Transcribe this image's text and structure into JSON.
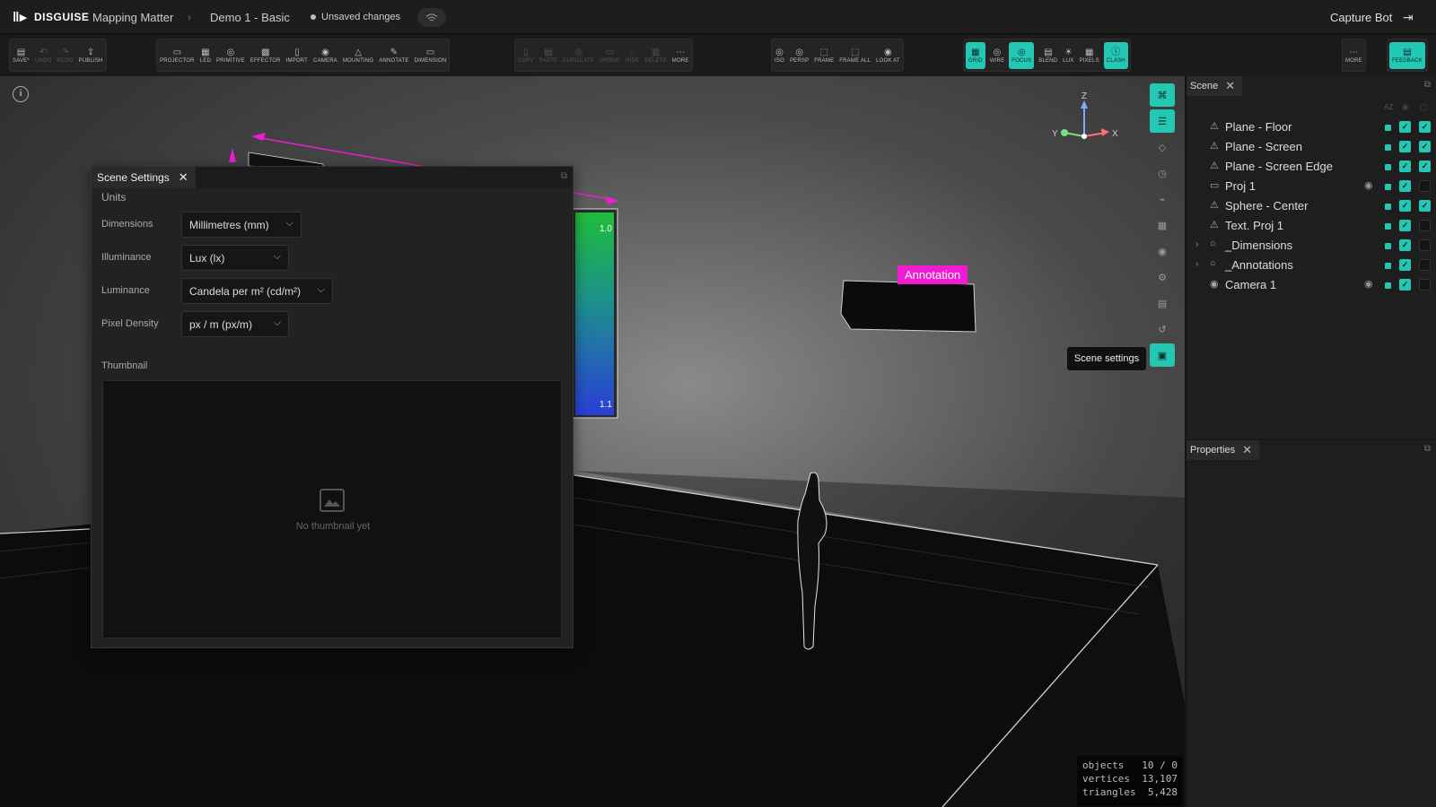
{
  "app": {
    "brand": "DISGUISE",
    "breadcrumb": [
      "Mapping Matter",
      "Demo 1 - Basic"
    ],
    "status": "Unsaved changes",
    "user": "Capture Bot"
  },
  "toolbar": {
    "groups": [
      [
        {
          "label": "SAVE*",
          "icon": "save-icon",
          "on": false,
          "dim": false
        },
        {
          "label": "UNDO",
          "icon": "undo-icon",
          "dim": true
        },
        {
          "label": "REDO",
          "icon": "redo-icon",
          "dim": true
        },
        {
          "label": "PUBLISH",
          "icon": "publish-icon",
          "dim": false
        }
      ],
      [
        {
          "label": "PROJECTOR",
          "icon": "projector-icon"
        },
        {
          "label": "LED",
          "icon": "led-icon"
        },
        {
          "label": "PRIMITIVE",
          "icon": "primitive-icon"
        },
        {
          "label": "EFFECTOR",
          "icon": "effector-icon"
        },
        {
          "label": "IMPORT",
          "icon": "import-icon"
        },
        {
          "label": "CAMERA",
          "icon": "camera-icon"
        },
        {
          "label": "MOUNTING",
          "icon": "mounting-icon"
        },
        {
          "label": "ANNOTATE",
          "icon": "annotate-icon"
        },
        {
          "label": "DIMENSION",
          "icon": "dimension-icon"
        }
      ],
      [
        {
          "label": "COPY",
          "icon": "copy-icon",
          "dim": true
        },
        {
          "label": "PASTE",
          "icon": "paste-icon",
          "dim": true
        },
        {
          "label": "DUPLICATE",
          "icon": "duplicate-icon",
          "dim": true
        },
        {
          "label": "GROUP",
          "icon": "group-icon",
          "dim": true
        },
        {
          "label": "HIDE",
          "icon": "hide-icon",
          "dim": true
        },
        {
          "label": "DELETE",
          "icon": "delete-icon",
          "dim": true
        },
        {
          "label": "MORE",
          "icon": "more-icon"
        }
      ],
      [
        {
          "label": "ISO",
          "icon": "iso-icon"
        },
        {
          "label": "PERSP",
          "icon": "persp-icon"
        },
        {
          "label": "FRAME",
          "icon": "frame-icon"
        },
        {
          "label": "FRAME ALL",
          "icon": "frame-all-icon"
        },
        {
          "label": "LOOK AT",
          "icon": "look-at-icon"
        }
      ],
      [
        {
          "label": "GRID",
          "icon": "grid-icon",
          "on": true
        },
        {
          "label": "WIRE",
          "icon": "wire-icon"
        },
        {
          "label": "FOCUS",
          "icon": "focus-icon",
          "on": true
        },
        {
          "label": "BLEND",
          "icon": "blend-icon"
        },
        {
          "label": "LUX",
          "icon": "lux-icon"
        },
        {
          "label": "PIXELS",
          "icon": "pixels-icon"
        },
        {
          "label": "CLASH",
          "icon": "clash-icon",
          "on": true
        }
      ],
      [
        {
          "label": "MORE",
          "icon": "more-icon"
        }
      ],
      [
        {
          "label": "FEEDBACK",
          "icon": "feedback-icon",
          "on": true
        }
      ]
    ]
  },
  "scene_panel": {
    "title": "Scene",
    "items": [
      {
        "name": "Plane - Floor",
        "icon": "plane-icon",
        "eye": false,
        "c1": true,
        "c2": true,
        "expand": false
      },
      {
        "name": "Plane - Screen",
        "icon": "plane-icon",
        "eye": false,
        "c1": true,
        "c2": true,
        "expand": false
      },
      {
        "name": "Plane - Screen Edge",
        "icon": "plane-icon",
        "eye": false,
        "c1": true,
        "c2": true,
        "expand": false
      },
      {
        "name": "Proj 1",
        "icon": "projector-icon",
        "eye": true,
        "c1": true,
        "c2": false,
        "expand": false
      },
      {
        "name": "Sphere - Center",
        "icon": "plane-icon",
        "eye": false,
        "c1": true,
        "c2": true,
        "expand": false
      },
      {
        "name": "Text. Proj 1",
        "icon": "plane-icon",
        "eye": false,
        "c1": true,
        "c2": false,
        "expand": false
      },
      {
        "name": "_Dimensions",
        "icon": "group-icon",
        "eye": false,
        "c1": true,
        "c2": false,
        "expand": true
      },
      {
        "name": "_Annotations",
        "icon": "group-icon",
        "eye": false,
        "c1": true,
        "c2": false,
        "expand": true
      },
      {
        "name": "Camera 1",
        "icon": "camera-icon",
        "eye": true,
        "c1": true,
        "c2": false,
        "expand": false
      }
    ]
  },
  "properties_panel": {
    "title": "Properties"
  },
  "scene_settings": {
    "title": "Scene Settings",
    "units_label": "Units",
    "fields": [
      {
        "label": "Dimensions",
        "value": "Millimetres (mm)"
      },
      {
        "label": "Illuminance",
        "value": "Lux (lx)"
      },
      {
        "label": "Luminance",
        "value": "Candela per m² (cd/m²)"
      },
      {
        "label": "Pixel Density",
        "value": "px / m (px/m)"
      }
    ],
    "thumbnail_label": "Thumbnail",
    "thumbnail_empty": "No thumbnail yet"
  },
  "viewport": {
    "annotation": "Annotation",
    "tooltip": "Scene settings",
    "axis": {
      "z": "Z",
      "y": "Y",
      "x": "X"
    },
    "screen_labels": [
      "1.0",
      "1.1"
    ],
    "stats": [
      {
        "k": "objects",
        "v": "10 / 0"
      },
      {
        "k": "vertices",
        "v": "13,107"
      },
      {
        "k": "triangles",
        "v": "5,428"
      }
    ]
  },
  "colors": {
    "accent": "#23c7b3",
    "annotation": "#f21bd4"
  }
}
